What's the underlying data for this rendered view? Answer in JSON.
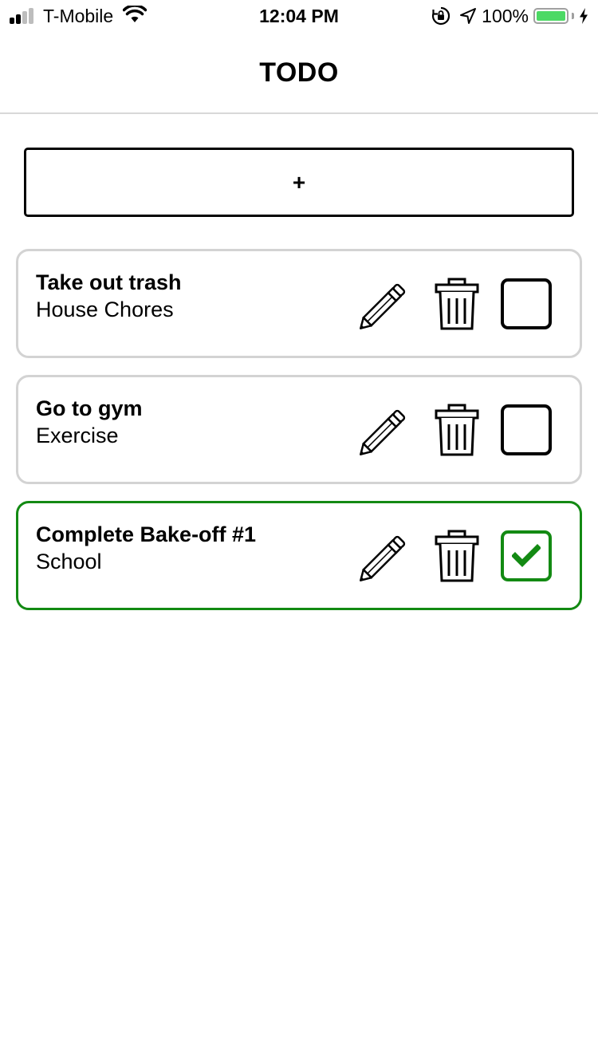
{
  "status_bar": {
    "carrier": "T-Mobile",
    "time": "12:04 PM",
    "battery_percent": "100%",
    "battery_level": 1.0,
    "battery_color": "#4cd964",
    "signal_bars": 4,
    "signal_active_bars": 2,
    "icons": [
      "cellular-signal-icon",
      "wifi-icon",
      "orientation-lock-icon",
      "location-arrow-icon",
      "battery-icon",
      "charging-bolt-icon"
    ]
  },
  "header": {
    "title": "TODO"
  },
  "add_button": {
    "label": "+"
  },
  "todos": [
    {
      "title": "Take out trash",
      "category": "House Chores",
      "completed": false
    },
    {
      "title": "Go to gym",
      "category": "Exercise",
      "completed": false
    },
    {
      "title": "Complete Bake-off #1",
      "category": "School",
      "completed": true
    }
  ],
  "colors": {
    "card_border": "#d3d3d3",
    "completed_accent": "#138a13",
    "divider": "#d8d8d8"
  },
  "item_icons": {
    "edit": "pencil-icon",
    "delete": "trash-icon",
    "complete": "checkbox-icon"
  }
}
